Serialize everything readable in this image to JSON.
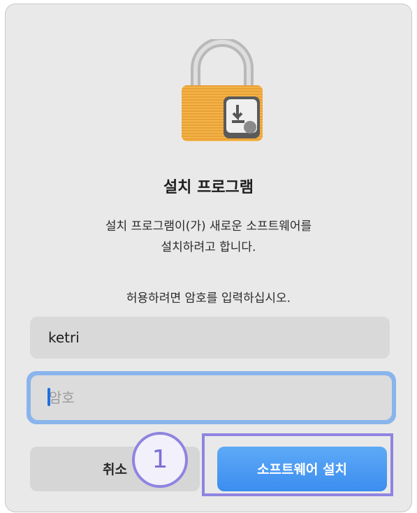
{
  "dialog": {
    "icon": "installer-lock-icon",
    "title": "설치 프로그램",
    "message_line1": "설치 프로그램이(가) 새로운 소프트웨어를",
    "message_line2": "설치하려고 합니다.",
    "prompt": "허용하려면 암호를 입력하십시오.",
    "username_value": "ketri",
    "password_placeholder": "암호",
    "password_value": "",
    "cancel_label": "취소",
    "install_label": "소프트웨어 설치"
  },
  "annotation": {
    "step_number": "1",
    "color": "#8f84e0"
  },
  "colors": {
    "accent": "#3b8def",
    "focus_ring": "#8ab4ec"
  }
}
